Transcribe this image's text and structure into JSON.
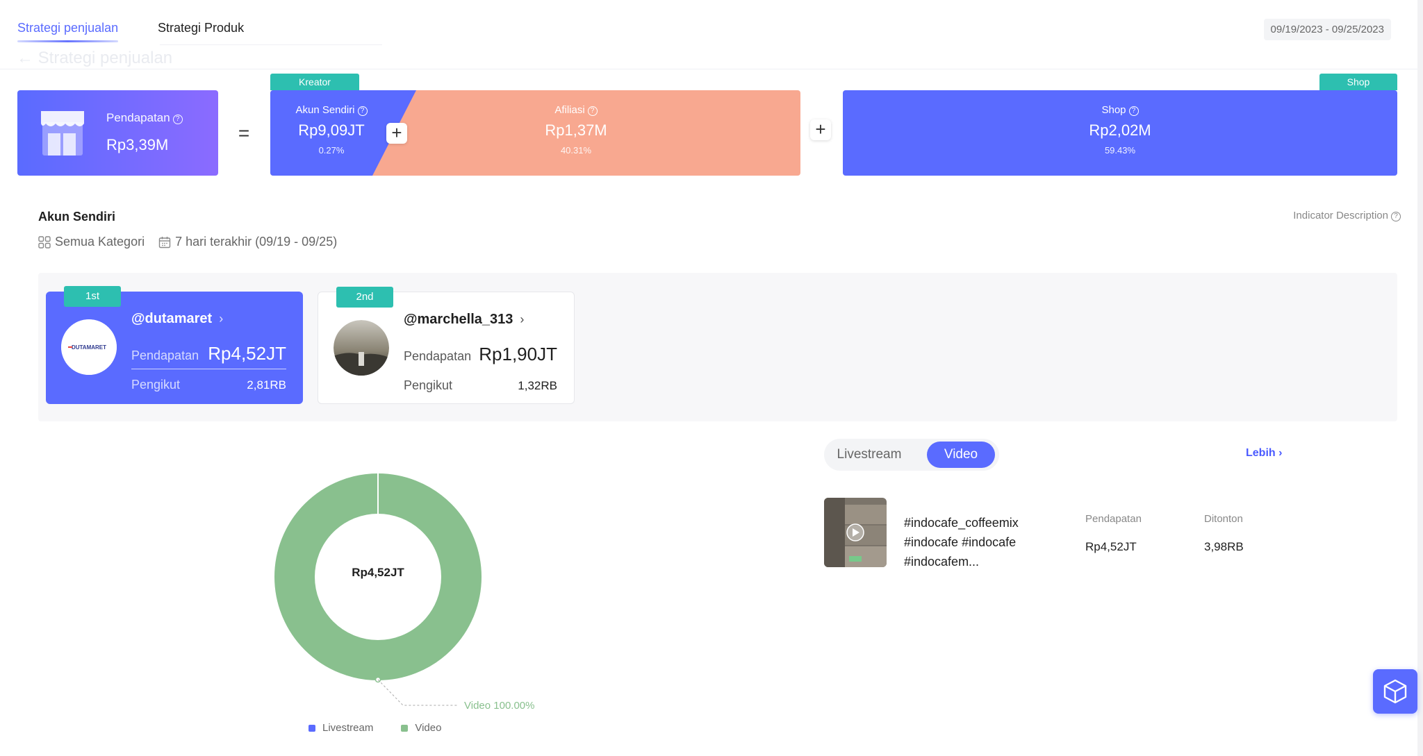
{
  "tabs": [
    {
      "label": "Strategi penjualan",
      "active": true
    },
    {
      "label": "Strategi Produk",
      "active": false
    }
  ],
  "date_range": "09/19/2023 - 09/25/2023",
  "ghost_title": "← Strategi penjualan",
  "formula": {
    "revenue": {
      "label": "Pendapatan",
      "value": "Rp3,39M"
    },
    "equals": "=",
    "plus": "+",
    "creator_badge": "Kreator",
    "own_account": {
      "label": "Akun Sendiri",
      "value": "Rp9,09JT",
      "pct": "0.27%"
    },
    "affiliate": {
      "label": "Afiliasi",
      "value": "Rp1,37M",
      "pct": "40.31%"
    },
    "shop_badge": "Shop",
    "shop": {
      "label": "Shop",
      "value": "Rp2,02M",
      "pct": "59.43%"
    }
  },
  "section": {
    "title": "Akun Sendiri",
    "indicator": "Indicator Description",
    "category_filter": "Semua Kategori",
    "period_filter": "7 hari terakhir (09/19 - 09/25)"
  },
  "creators": [
    {
      "rank": "1st",
      "handle": "@dutamaret",
      "avatar_text": "DUTAMARET",
      "revenue_label": "Pendapatan",
      "revenue": "Rp4,52JT",
      "followers_label": "Pengikut",
      "followers": "2,81RB"
    },
    {
      "rank": "2nd",
      "handle": "@marchella_313",
      "revenue_label": "Pendapatan",
      "revenue": "Rp1,90JT",
      "followers_label": "Pengikut",
      "followers": "1,32RB"
    }
  ],
  "donut": {
    "center_value": "Rp4,52JT",
    "callout": "Video 100.00%",
    "legend": [
      {
        "label": "Livestream",
        "color": "#5a6bff"
      },
      {
        "label": "Video",
        "color": "#89c08e"
      }
    ],
    "shares": [
      {
        "name": "Livestream",
        "value": 0
      },
      {
        "name": "Video",
        "value": 100
      }
    ]
  },
  "video_panel": {
    "segments": [
      "Livestream",
      "Video"
    ],
    "active_segment": "Video",
    "more_label": "Lebih",
    "items": [
      {
        "title": "#indocafe_coffeemix #indocafe #indocafe #indocafem...",
        "revenue_label": "Pendapatan",
        "revenue": "Rp4,52JT",
        "views_label": "Ditonton",
        "views": "3,98RB"
      }
    ]
  },
  "colors": {
    "primary": "#5a6bff",
    "teal": "#2dbfb0",
    "salmon": "#f8a890",
    "green": "#89c08e"
  }
}
